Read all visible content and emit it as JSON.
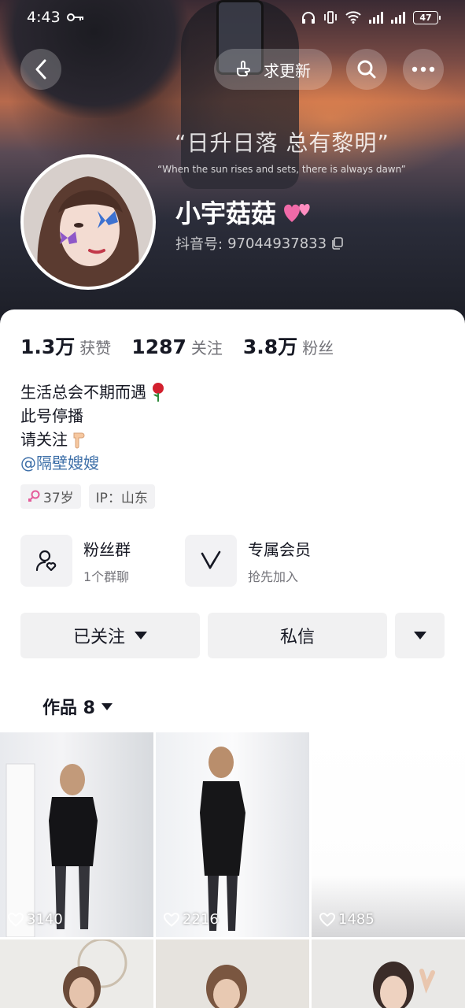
{
  "status_bar": {
    "time": "4:43",
    "battery": "47"
  },
  "header": {
    "update_label": "求更新",
    "cover_quote": "“日升日落 总有黎明”",
    "cover_quote_en": "“When the sun rises and sets, there is always dawn”"
  },
  "profile": {
    "nickname": "小宇菇菇",
    "douyin_id_label": "抖音号:",
    "douyin_id": "97044937833"
  },
  "stats": [
    {
      "value": "1.3万",
      "label": "获赞"
    },
    {
      "value": "1287",
      "label": "关注"
    },
    {
      "value": "3.8万",
      "label": "粉丝"
    }
  ],
  "bio": {
    "line1": "生活总会不期而遇",
    "line2": "此号停播",
    "line3": "请关注",
    "mention": "@隔壁嫂嫂"
  },
  "tags": {
    "age": "37岁",
    "ip": "IP：山东"
  },
  "features": [
    {
      "title": "粉丝群",
      "subtitle": "1个群聊"
    },
    {
      "title": "专属会员",
      "subtitle": "抢先加入"
    }
  ],
  "actions": {
    "followed": "已关注",
    "message": "私信"
  },
  "works": {
    "label": "作品 8"
  },
  "grid": [
    {
      "likes": "3140"
    },
    {
      "likes": "2216"
    },
    {
      "likes": "1485"
    }
  ],
  "colors": {
    "accent": "#fe2c55",
    "link": "#3d6fa8",
    "button_bg": "#f1f1f2"
  }
}
